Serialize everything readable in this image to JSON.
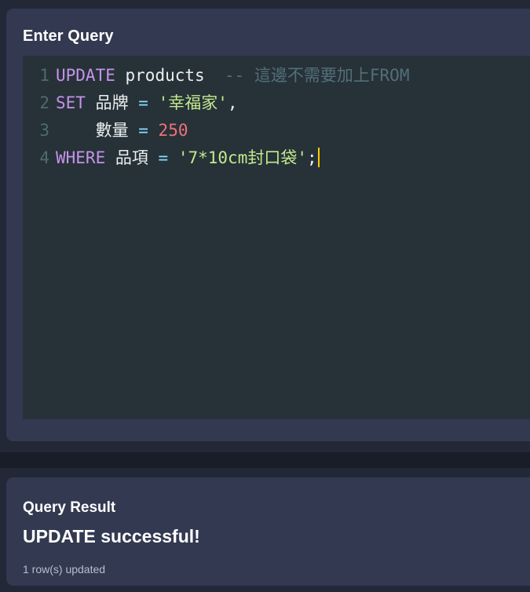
{
  "theme": {
    "page_background": "#222836",
    "panel_background": "#333950",
    "editor_background": "#263238",
    "band_color": "#191d28",
    "keyword_color": "#c792ea",
    "identifier_color": "#eceff1",
    "operator_color": "#89ddff",
    "string_color": "#c3e88d",
    "number_color": "#f07178",
    "comment_color": "#546e7a",
    "line_number_color": "#4f6b6f",
    "caret_color": "#ffcc00"
  },
  "query_panel": {
    "title": "Enter Query",
    "editor": {
      "lines": [
        {
          "number": "1",
          "tokens": [
            {
              "text": "UPDATE",
              "type": "kw"
            },
            {
              "text": " ",
              "type": "punc"
            },
            {
              "text": "products",
              "type": "ident"
            },
            {
              "text": "  ",
              "type": "punc"
            },
            {
              "text": "-- 這邊不需要加上FROM",
              "type": "comment"
            }
          ]
        },
        {
          "number": "2",
          "tokens": [
            {
              "text": "SET",
              "type": "kw"
            },
            {
              "text": " ",
              "type": "punc"
            },
            {
              "text": "品牌",
              "type": "ident"
            },
            {
              "text": " ",
              "type": "punc"
            },
            {
              "text": "=",
              "type": "op"
            },
            {
              "text": " ",
              "type": "punc"
            },
            {
              "text": "'幸福家'",
              "type": "str"
            },
            {
              "text": ",",
              "type": "punc"
            }
          ]
        },
        {
          "number": "3",
          "tokens": [
            {
              "text": "    ",
              "type": "punc"
            },
            {
              "text": "數量",
              "type": "ident"
            },
            {
              "text": " ",
              "type": "punc"
            },
            {
              "text": "=",
              "type": "op"
            },
            {
              "text": " ",
              "type": "punc"
            },
            {
              "text": "250",
              "type": "num"
            }
          ]
        },
        {
          "number": "4",
          "tokens": [
            {
              "text": "WHERE",
              "type": "kw"
            },
            {
              "text": " ",
              "type": "punc"
            },
            {
              "text": "品項",
              "type": "ident"
            },
            {
              "text": " ",
              "type": "punc"
            },
            {
              "text": "=",
              "type": "op"
            },
            {
              "text": " ",
              "type": "punc"
            },
            {
              "text": "'7*10cm封口袋'",
              "type": "str"
            },
            {
              "text": ";",
              "type": "punc"
            }
          ],
          "caret": true
        }
      ],
      "full_text": "UPDATE products  -- 這邊不需要加上FROM\nSET 品牌 = '幸福家',\n    數量 = 250\nWHERE 品項 = '7*10cm封口袋';"
    }
  },
  "result_panel": {
    "title": "Query Result",
    "message": "UPDATE successful!",
    "detail": "1 row(s) updated"
  }
}
